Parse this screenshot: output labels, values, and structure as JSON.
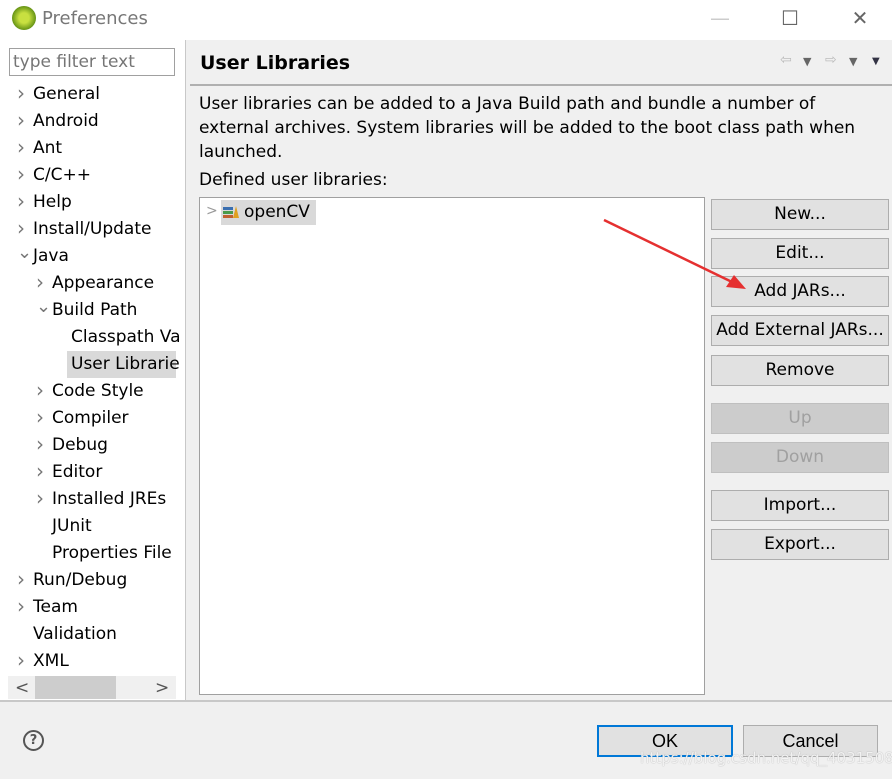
{
  "window": {
    "title": "Preferences",
    "minimize": "—",
    "maximize": "☐",
    "close": "✕"
  },
  "filter": {
    "placeholder": "type filter text"
  },
  "tree": [
    {
      "label": "General",
      "level": 0,
      "chevron": ">"
    },
    {
      "label": "Android",
      "level": 0,
      "chevron": ">"
    },
    {
      "label": "Ant",
      "level": 0,
      "chevron": ">"
    },
    {
      "label": "C/C++",
      "level": 0,
      "chevron": ">"
    },
    {
      "label": "Help",
      "level": 0,
      "chevron": ">"
    },
    {
      "label": "Install/Update",
      "level": 0,
      "chevron": ">"
    },
    {
      "label": "Java",
      "level": 0,
      "chevron": "v"
    },
    {
      "label": "Appearance",
      "level": 1,
      "chevron": ">"
    },
    {
      "label": "Build Path",
      "level": 1,
      "chevron": "v"
    },
    {
      "label": "Classpath Va",
      "level": 2,
      "chevron": ""
    },
    {
      "label": "User Librarie",
      "level": 2,
      "chevron": "",
      "selected": true
    },
    {
      "label": "Code Style",
      "level": 1,
      "chevron": ">"
    },
    {
      "label": "Compiler",
      "level": 1,
      "chevron": ">"
    },
    {
      "label": "Debug",
      "level": 1,
      "chevron": ">"
    },
    {
      "label": "Editor",
      "level": 1,
      "chevron": ">"
    },
    {
      "label": "Installed JREs",
      "level": 1,
      "chevron": ">"
    },
    {
      "label": "JUnit",
      "level": 1,
      "chevron": ""
    },
    {
      "label": "Properties File",
      "level": 1,
      "chevron": ""
    },
    {
      "label": "Run/Debug",
      "level": 0,
      "chevron": ">"
    },
    {
      "label": "Team",
      "level": 0,
      "chevron": ">"
    },
    {
      "label": "Validation",
      "level": 0,
      "chevron": ""
    },
    {
      "label": "XML",
      "level": 0,
      "chevron": ">"
    }
  ],
  "page": {
    "title": "User Libraries",
    "description": "User libraries can be added to a Java Build path and bundle a number of external archives. System libraries will be added to the boot class path when launched.",
    "defined_label": "Defined user libraries:",
    "libraries": [
      {
        "name": "openCV",
        "icon": "library-icon"
      }
    ],
    "buttons": [
      {
        "label": "New...",
        "enabled": true
      },
      {
        "label": "Edit...",
        "enabled": true
      },
      {
        "label": "Add JARs...",
        "enabled": true
      },
      {
        "label": "Add External JARs...",
        "enabled": true
      },
      {
        "label": "Remove",
        "enabled": true
      },
      {
        "label": "Up",
        "enabled": false
      },
      {
        "label": "Down",
        "enabled": false
      },
      {
        "label": "Import...",
        "enabled": true
      },
      {
        "label": "Export...",
        "enabled": true
      }
    ]
  },
  "footer": {
    "ok": "OK",
    "cancel": "Cancel",
    "help": "?"
  },
  "watermark": "https://blog.csdn.net/qq_40315080",
  "colors": {
    "arrow": "#e53030",
    "focus": "#0078d7"
  }
}
